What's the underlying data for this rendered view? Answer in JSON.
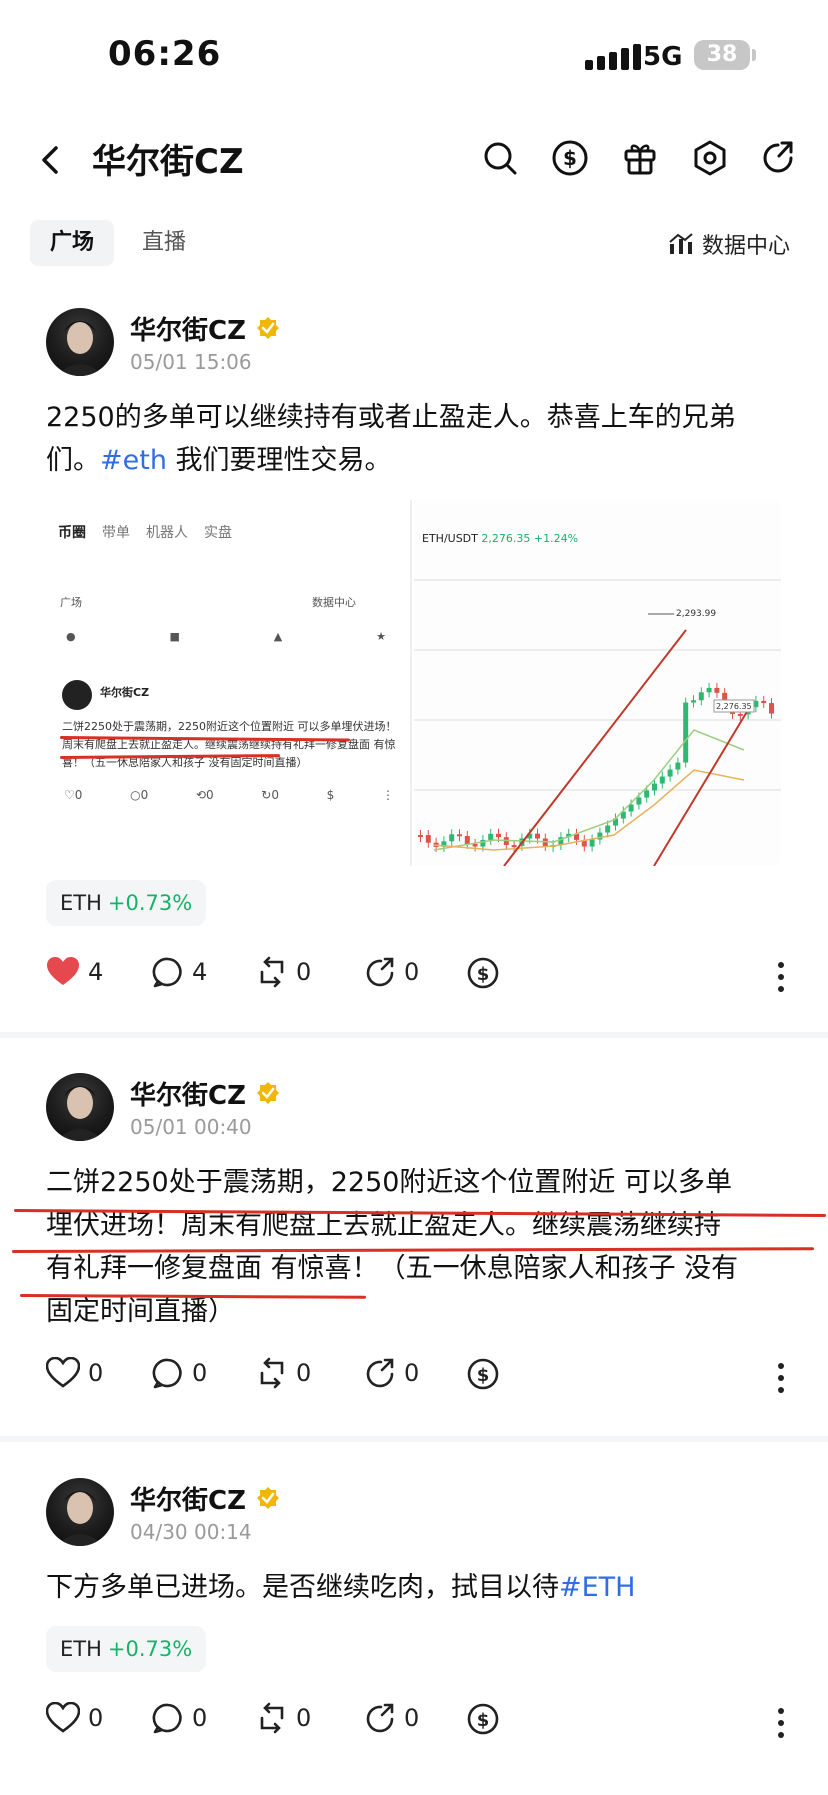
{
  "status_bar": {
    "time": "06:26",
    "network": "5G",
    "battery": "38"
  },
  "header": {
    "title": "华尔街CZ"
  },
  "tabs": [
    {
      "label": "广场"
    },
    {
      "label": "直播"
    }
  ],
  "data_center": {
    "label": "数据中心"
  },
  "posts": [
    {
      "author": "华尔街CZ",
      "time": "05/01 15:06",
      "text_a": "2250的多单可以继续持有或者止盈走人。恭喜上车的兄弟们。",
      "tag": "#eth",
      "text_b": " 我们要理性交易。",
      "ticker": {
        "symbol": "ETH",
        "change": "+0.73%"
      },
      "likes": "4",
      "comments": "4",
      "reposts": "0",
      "quotes": "0",
      "image": {
        "left_tabs": [
          "币圈",
          "带单",
          "机器人",
          "实盘"
        ],
        "left_sub": "广场",
        "left_data_center": "数据中心",
        "left_author": "华尔街CZ",
        "left_text": "二饼2250处于震荡期，2250附近这个位置附近 可以多单埋伏进场！周末有爬盘上去就止盈走人。继续震荡继续持有礼拜一修复盘面 有惊喜！（五一休息陪家人和孩子 没有固定时间直播）",
        "right_pair": "ETH/USDT",
        "right_price": "2,276.35",
        "right_change": "+1.24%",
        "price_high": "2,293.99",
        "price_last": "2,276.35"
      }
    },
    {
      "author": "华尔街CZ",
      "time": "05/01 00:40",
      "lines": [
        "二饼2250处于震荡期，2250附近这个位置附近 可以多单",
        "埋伏进场！周末有爬盘上去就止盈走人。继续震荡继续持",
        "有礼拜一修复盘面 有惊喜！（五一休息陪家人和孩子 没有",
        "固定时间直播）"
      ],
      "likes": "0",
      "comments": "0",
      "reposts": "0",
      "quotes": "0"
    },
    {
      "author": "华尔街CZ",
      "time": "04/30 00:14",
      "text_a": "下方多单已进场。是否继续吃肉，拭目以待",
      "tag": "#ETH",
      "ticker": {
        "symbol": "ETH",
        "change": "+0.73%"
      },
      "likes": "0",
      "comments": "0",
      "reposts": "0",
      "quotes": "0"
    }
  ],
  "colors": {
    "accent": "#2f6fe4",
    "positive": "#17b26a",
    "like": "#e5484d",
    "annotation": "#d93025"
  },
  "icons": [
    "back-arrow-icon",
    "search-icon",
    "dollar-coin-icon",
    "gift-icon",
    "hexagon-settings-icon",
    "share-icon",
    "chart-icon",
    "heart-icon",
    "comment-icon",
    "repost-icon",
    "quote-icon",
    "tip-icon",
    "more-icon"
  ]
}
